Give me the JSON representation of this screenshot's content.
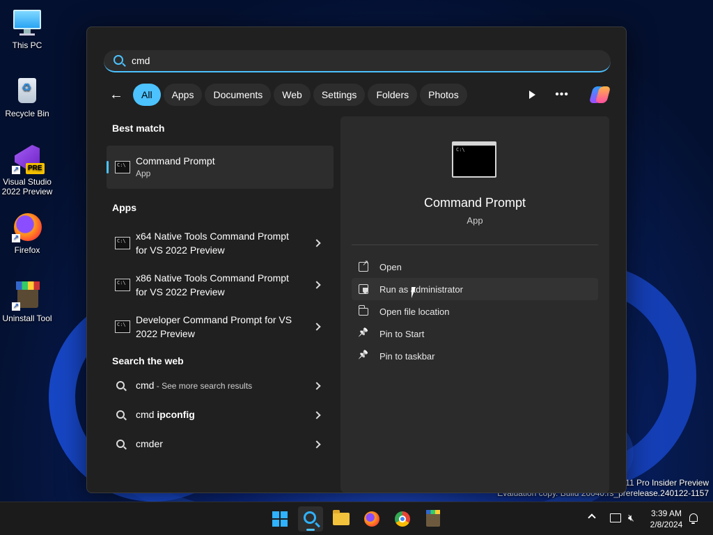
{
  "desktop": {
    "icons": [
      {
        "label": "This PC",
        "icon": "monitor-icon"
      },
      {
        "label": "Recycle Bin",
        "icon": "recycle-bin-icon"
      },
      {
        "label": "Visual Studio 2022 Preview",
        "icon": "visual-studio-icon",
        "badge": "PRE"
      },
      {
        "label": "Firefox",
        "icon": "firefox-icon"
      },
      {
        "label": "Uninstall Tool",
        "icon": "uninstall-tool-icon"
      }
    ],
    "watermark": {
      "line1": "s 11 Pro Insider Preview",
      "line2": "Evaluation copy. Build 26040.rs_prerelease.240122-1157"
    }
  },
  "search": {
    "query": "cmd",
    "filters": [
      "All",
      "Apps",
      "Documents",
      "Web",
      "Settings",
      "Folders",
      "Photos"
    ],
    "active_filter": "All"
  },
  "results": {
    "best_match_heading": "Best match",
    "best_match": {
      "title": "Command Prompt",
      "type": "App"
    },
    "apps_heading": "Apps",
    "apps": [
      {
        "title": "x64 Native Tools Command Prompt for VS 2022 Preview"
      },
      {
        "title": "x86 Native Tools Command Prompt for VS 2022 Preview"
      },
      {
        "title": "Developer Command Prompt for VS 2022 Preview"
      }
    ],
    "web_heading": "Search the web",
    "web": [
      {
        "query": "cmd",
        "suffix": " - See more search results"
      },
      {
        "query": "cmd ",
        "bold": "ipconfig"
      },
      {
        "query": "cmder"
      }
    ]
  },
  "detail": {
    "title": "Command Prompt",
    "subtitle": "App",
    "actions": [
      {
        "label": "Open",
        "icon": "open-external-icon"
      },
      {
        "label": "Run as administrator",
        "icon": "run-as-admin-icon"
      },
      {
        "label": "Open file location",
        "icon": "folder-icon"
      },
      {
        "label": "Pin to Start",
        "icon": "pin-icon"
      },
      {
        "label": "Pin to taskbar",
        "icon": "pin-icon"
      }
    ]
  },
  "taskbar": {
    "time": "3:39 AM",
    "date": "2/8/2024",
    "apps": [
      "start",
      "search",
      "file-explorer",
      "firefox",
      "chrome",
      "uninstall-tool"
    ]
  },
  "colors": {
    "accent": "#4cc2ff",
    "panel_bg": "#202020",
    "detail_bg": "#2b2b2b"
  }
}
